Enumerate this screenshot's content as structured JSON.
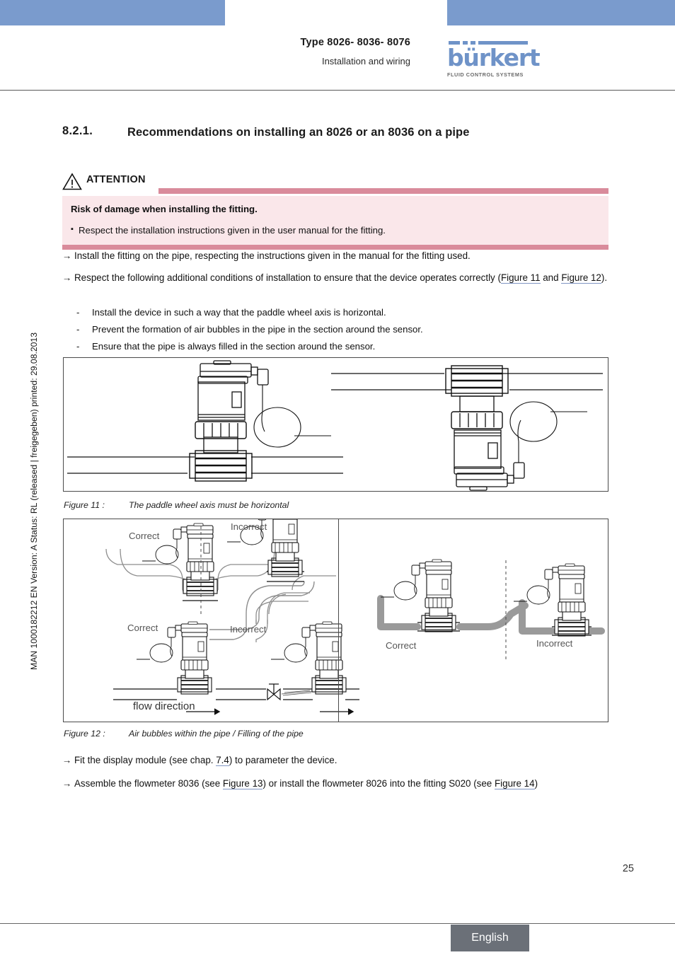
{
  "header": {
    "type_line": "Type 8026- 8036- 8076",
    "subtitle": "Installation and wiring",
    "logo_word": "bürkert",
    "logo_tagline": "FLUID CONTROL SYSTEMS",
    "logo_color": "#6f93c8",
    "band_color": "#7a9bcd"
  },
  "side_stamp": "MAN 1000182212  EN  Version: A  Status: RL (released | freigegeben)  printed: 29.08.2013",
  "section": {
    "number": "8.2.1.",
    "title": "Recommendations on installing an 8026 or an 8036 on a pipe"
  },
  "attention": {
    "label": "ATTENTION",
    "risk": "Risk of damage when installing the fitting.",
    "bullet": "Respect the installation instructions given in the user manual for the fitting.",
    "bar_color": "#d98b9b",
    "body_color": "#fae7ea"
  },
  "paragraphs": {
    "p1_a": "Install the fitting on the pipe, respecting the instructions given in the manual for the fitting used.",
    "p2_a": "Respect the following additional conditions of installation to ensure that the device operates correctly (",
    "p2_link1": "Figure 11",
    "p2_b": " and ",
    "p2_link2": "Figure 12",
    "p2_c": ").",
    "p3_a": "Fit the display module (see chap. ",
    "p3_link": "7.4",
    "p3_b": ") to parameter the device.",
    "p4_a": "Assemble the flowmeter 8036 (see ",
    "p4_link1": "Figure 13",
    "p4_b": ") or install the flowmeter 8026 into the fitting S020 (see ",
    "p4_link2": "Figure 14",
    "p4_c": ")"
  },
  "sublist": [
    "Install the device in such a way that the paddle wheel axis is horizontal.",
    "Prevent the formation of air bubbles in the pipe in the section around the sensor.",
    "Ensure that the pipe is always filled in the section around the sensor."
  ],
  "figure11": {
    "caption_number": "Figure 11 :",
    "caption_text": "The paddle wheel axis must be horizontal"
  },
  "figure12": {
    "caption_number": "Figure 12 :",
    "caption_text": "Air bubbles within the pipe / Filling of the pipe",
    "label_correct_1": "Correct",
    "label_incorrect_1": "Incorrect",
    "label_correct_2": "Correct",
    "label_incorrect_2": "Incorrect",
    "label_flow": "flow direction",
    "label_correct_3": "Correct",
    "label_incorrect_3": "Incorrect"
  },
  "footer": {
    "page_number": "25",
    "language": "English",
    "tab_color": "#6b7078"
  }
}
